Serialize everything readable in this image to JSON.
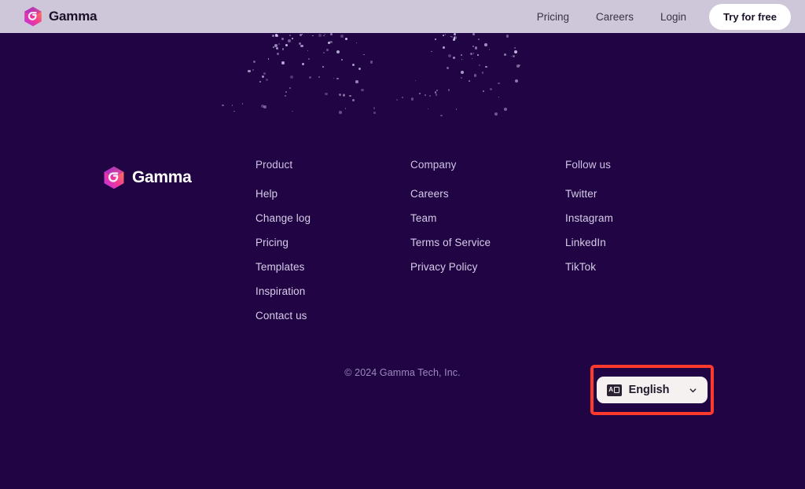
{
  "header": {
    "brand": "Gamma",
    "logo_icon": "gamma-logo-icon",
    "nav": [
      {
        "label": "Pricing"
      },
      {
        "label": "Careers"
      },
      {
        "label": "Login"
      }
    ],
    "cta": "Try for free"
  },
  "footer": {
    "brand": "Gamma",
    "logo_icon": "gamma-logo-icon",
    "columns": [
      {
        "title": "Product",
        "links": [
          {
            "label": "Help"
          },
          {
            "label": "Change log"
          },
          {
            "label": "Pricing"
          },
          {
            "label": "Templates"
          },
          {
            "label": "Inspiration"
          },
          {
            "label": "Contact us"
          }
        ]
      },
      {
        "title": "Company",
        "links": [
          {
            "label": "Careers"
          },
          {
            "label": "Team"
          },
          {
            "label": "Terms of Service"
          },
          {
            "label": "Privacy Policy"
          }
        ]
      },
      {
        "title": "Follow us",
        "links": [
          {
            "label": "Twitter"
          },
          {
            "label": "Instagram"
          },
          {
            "label": "LinkedIn"
          },
          {
            "label": "TikTok"
          }
        ]
      }
    ],
    "copyright": "© 2024 Gamma Tech, Inc."
  },
  "language_selector": {
    "value": "English",
    "icon": "translate-icon",
    "chevron": "chevron-down-icon",
    "highlight_color": "#fc3b2d"
  },
  "colors": {
    "page_bg": "#210444",
    "header_bg": "#cdc7d9",
    "link": "#d6cde9",
    "muted": "#9b8bbd",
    "cta_bg": "#ffffff",
    "lang_bg": "#f5f1f1"
  }
}
